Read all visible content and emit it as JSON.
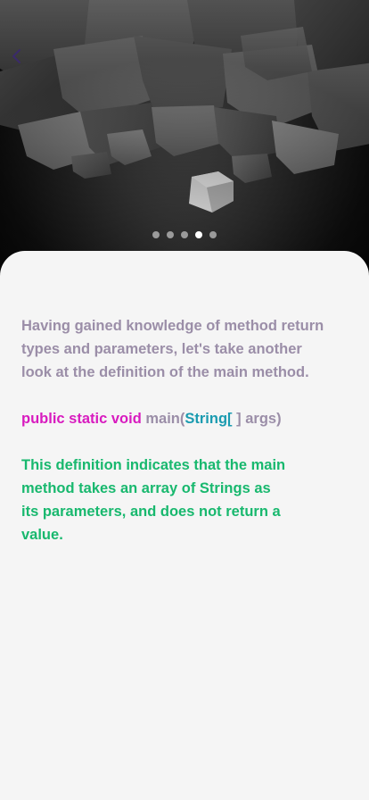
{
  "lesson": {
    "intro": "Having gained knowledge of method return types and parameters, let's take another look at the definition of the main method.",
    "code": {
      "keywords": "public static void",
      "method": "main(",
      "type": "String[",
      "rest": " ] args)"
    },
    "description": "This definition indicates that the main method takes an array of Strings as its parameters, and does not return a value."
  },
  "pager": {
    "total": 5,
    "active_index": 4
  },
  "icons": {
    "back": "chevron-left-icon"
  },
  "colors": {
    "intro_text": "#9b8ea8",
    "keyword": "#d81bbf",
    "type": "#1a9bb0",
    "description": "#18b86e",
    "back_icon": "#3a2a6a"
  }
}
